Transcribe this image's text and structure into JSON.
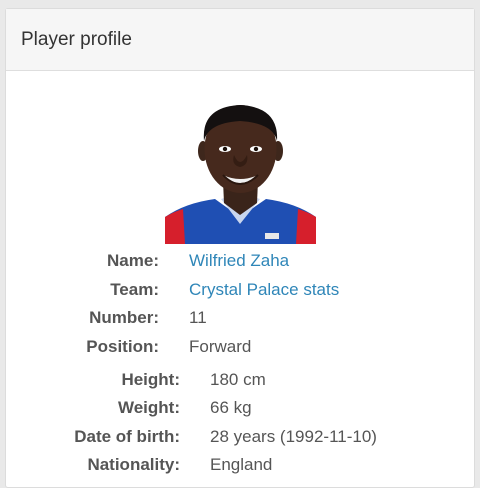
{
  "panel": {
    "title": "Player profile"
  },
  "player": {
    "photo_icon": "player-headshot",
    "colors": {
      "shirt_blue": "#1f4fb3",
      "shirt_red": "#d61f2c",
      "link": "#2f86b8"
    },
    "info": {
      "name": {
        "label": "Name:",
        "value": "Wilfried Zaha"
      },
      "team": {
        "label": "Team:",
        "value": "Crystal Palace stats"
      },
      "number": {
        "label": "Number:",
        "value": "11"
      },
      "position": {
        "label": "Position:",
        "value": "Forward"
      },
      "height": {
        "label": "Height:",
        "value": "180 cm"
      },
      "weight": {
        "label": "Weight:",
        "value": "66 kg"
      },
      "dob": {
        "label": "Date of birth:",
        "value": "28 years (1992-11-10)"
      },
      "nationality": {
        "label": "Nationality:",
        "value": "England"
      }
    }
  }
}
